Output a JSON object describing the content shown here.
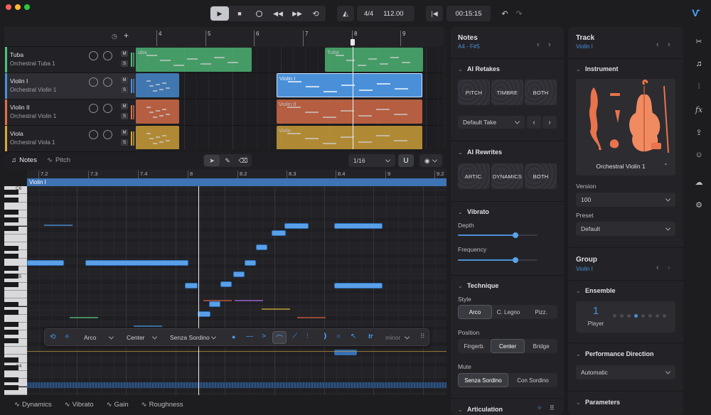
{
  "transport": {
    "signature": "4/4",
    "tempo": "112.00",
    "time": "00:15:15"
  },
  "ruler": {
    "bars": [
      "4",
      "5",
      "6",
      "7",
      "8",
      "9"
    ]
  },
  "tracks": [
    {
      "name": "Tuba",
      "instrument": "Orchestral Tuba 1",
      "color": "#4fbf7a"
    },
    {
      "name": "Violin I",
      "instrument": "Orchestral Violin 1",
      "color": "#4a90d9"
    },
    {
      "name": "Violin II",
      "instrument": "Orchestral Violin 1",
      "color": "#e0704a"
    },
    {
      "name": "Viola",
      "instrument": "Orchestral Viola 1",
      "color": "#d9a83a"
    }
  ],
  "clips": {
    "tuba": "Tuba",
    "violin1": "Violin I",
    "violin2": "Violin II",
    "viola": "Viola",
    "tuba_left": "uba"
  },
  "editor": {
    "tab_notes": "Notes",
    "tab_pitch": "Pitch",
    "quantize": "1/16",
    "region": "Violin I",
    "ruler": [
      "7.2",
      "7.3",
      "7.4",
      "8",
      "8.2",
      "8.3",
      "8.4",
      "9",
      "9.2"
    ],
    "key_c6": "C6",
    "key_c5": "C5",
    "key_c4": "C4"
  },
  "toolbar": {
    "articulation": "Arco",
    "position": "Center",
    "mute": "Senza Sordino",
    "scale": "minor"
  },
  "lanes": [
    "Dynamics",
    "Vibrato",
    "Gain",
    "Roughness"
  ],
  "notes_panel": {
    "title": "Notes",
    "range": "A4 - F#5",
    "ai_retakes": "AI Retakes",
    "retake_tiles": [
      "PITCH",
      "TIMBRE",
      "BOTH"
    ],
    "take": "Default Take",
    "ai_rewrites": "AI Rewrites",
    "rewrite_tiles": [
      "ARTIC.",
      "DYNAMICS",
      "BOTH"
    ],
    "vibrato": "Vibrato",
    "depth": "Depth",
    "depth_value": 0.72,
    "frequency": "Frequency",
    "frequency_value": 0.72,
    "technique": "Technique",
    "style": "Style",
    "style_opts": [
      "Arco",
      "C. Legno",
      "Pizz."
    ],
    "position": "Position",
    "position_opts": [
      "Fingerb.",
      "Center",
      "Bridge"
    ],
    "mute": "Mute",
    "mute_opts": [
      "Senza Sordino",
      "Con Sordino"
    ],
    "articulation": "Articulation"
  },
  "track_panel": {
    "title": "Track",
    "subtitle": "Violin I",
    "instrument_h": "Instrument",
    "instrument_name": "Orchestral Violin 1",
    "version_l": "Version",
    "version": "100",
    "preset_l": "Preset",
    "preset": "Default",
    "group": "Group",
    "group_sub": "Violin I",
    "ensemble": "Ensemble",
    "players": "1",
    "players_l": "Player",
    "perf": "Performance Direction",
    "perf_val": "Automatic",
    "params": "Parameters"
  },
  "colors": {
    "accent": "#4a90d9",
    "tuba": "#4fbf7a",
    "violin1": "#4a90d9",
    "violin2": "#e0704a",
    "viola": "#d9a83a"
  }
}
